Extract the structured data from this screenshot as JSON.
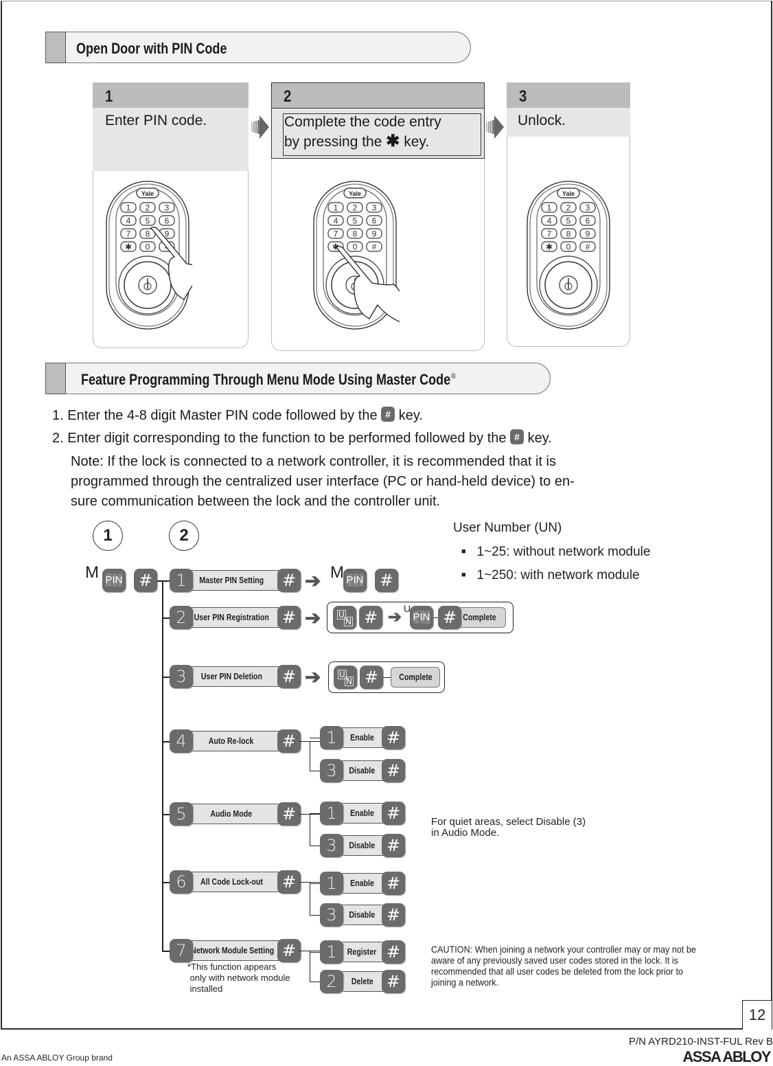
{
  "section1": {
    "title": "Open Door with PIN Code",
    "steps": [
      {
        "number": "1",
        "text": "Enter PIN code."
      },
      {
        "number": "2",
        "text_line1": "Complete the code entry",
        "text_line2_pre": "by pressing the",
        "star": "✱",
        "text_line2_post": "key."
      },
      {
        "number": "3",
        "text": "Unlock."
      }
    ],
    "lock_brand": "Yale",
    "keypad": [
      "1",
      "2",
      "3",
      "4",
      "5",
      "6",
      "7",
      "8",
      "9",
      "✱",
      "0",
      "#"
    ]
  },
  "section2": {
    "title": "Feature Programming Through Menu Mode Using Master Code",
    "title_mark": "✲",
    "instructions": [
      {
        "pre": "1. Enter the 4-8 digit Master PIN code followed by the",
        "key": "#",
        "post": "key."
      },
      {
        "pre": "2. Enter digit corresponding to the function to be performed followed by the",
        "key": "#",
        "post": "key."
      }
    ],
    "note_lines": [
      "Note: If the lock is connected to a network controller, it is recommended that it is",
      "programmed through the centralized user interface (PC or hand-held device) to en-",
      "sure communication between the lock and the controller unit."
    ]
  },
  "flow": {
    "circle_1": "1",
    "circle_2": "2",
    "m_label": "M",
    "u_label": "U",
    "pin_label": "PIN",
    "hash": "#",
    "un_u": "U",
    "un_n": "N",
    "complete": "Complete",
    "menu": [
      {
        "digit": "1",
        "label": "Master PIN Setting"
      },
      {
        "digit": "2",
        "label": "User PIN Registration"
      },
      {
        "digit": "3",
        "label": "User PIN Deletion"
      },
      {
        "digit": "4",
        "label": "Auto Re-lock",
        "options": [
          {
            "digit": "1",
            "label": "Enable"
          },
          {
            "digit": "3",
            "label": "Disable"
          }
        ]
      },
      {
        "digit": "5",
        "label": "Audio Mode",
        "options": [
          {
            "digit": "1",
            "label": "Enable"
          },
          {
            "digit": "3",
            "label": "Disable"
          }
        ]
      },
      {
        "digit": "6",
        "label": "All Code Lock-out",
        "options": [
          {
            "digit": "1",
            "label": "Enable"
          },
          {
            "digit": "3",
            "label": "Disable"
          }
        ]
      },
      {
        "digit": "7",
        "label": "*Network Module Setting",
        "options": [
          {
            "digit": "1",
            "label": "Register"
          },
          {
            "digit": "2",
            "label": "Delete"
          }
        ]
      }
    ],
    "network_note": [
      "*This function appears",
      " only with network module",
      " installed"
    ]
  },
  "user_number": {
    "title": "User Number (UN)",
    "items": [
      "1~25: without network module",
      "1~250: with network module"
    ]
  },
  "audio_note": [
    "For quiet areas, select Disable (3)",
    "in Audio Mode."
  ],
  "caution": "CAUTION: When joining a network your controller may or may not be aware of any previously saved user codes stored in the lock. It is recommended that all user codes be deleted from the lock prior to joining a network.",
  "footer": {
    "page_number": "12",
    "part_number": "P/N AYRD210-INST-FUL Rev B",
    "brand_line": "An ASSA ABLOY Group brand",
    "logo": "ASSA ABLOY"
  }
}
